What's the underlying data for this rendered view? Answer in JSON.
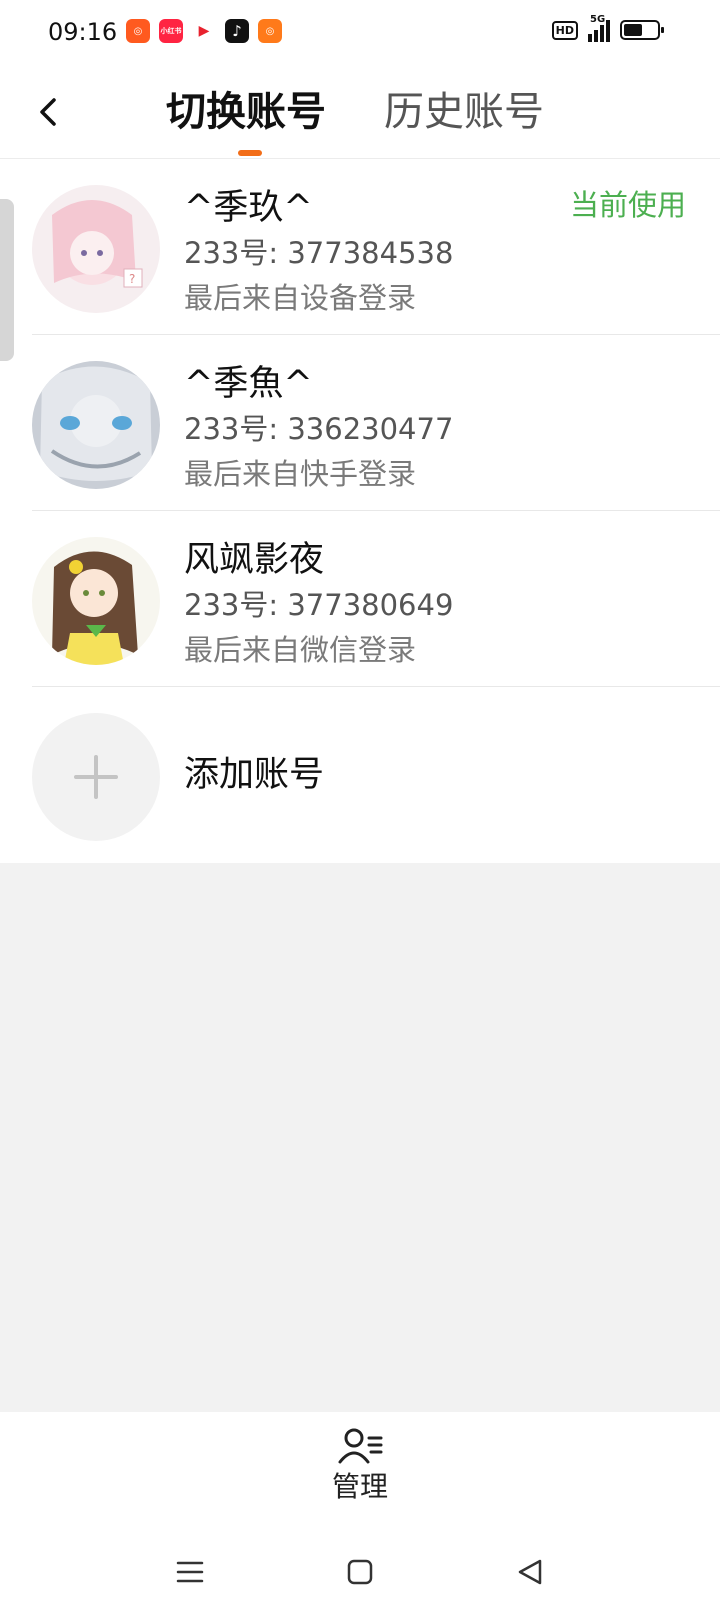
{
  "status_bar": {
    "time": "09:16",
    "hd": "HD",
    "network": "5G",
    "battery_level": 0.55,
    "app_icons": [
      {
        "name": "kuaishou-icon",
        "color": "#ff5a1f",
        "glyph": "⦿"
      },
      {
        "name": "xiaohongshu-icon",
        "color": "#ff2442",
        "glyph": "小红书"
      },
      {
        "name": "red-play-icon",
        "color": "#ffffff",
        "glyph": "▶"
      },
      {
        "name": "tiktok-icon",
        "color": "#111111",
        "glyph": "♪"
      },
      {
        "name": "kuaishou-lite-icon",
        "color": "#ff7a1a",
        "glyph": "⦿"
      }
    ]
  },
  "header": {
    "tab_active": "切换账号",
    "tab_inactive": "历史账号",
    "accent_color": "#f26d18"
  },
  "accounts": [
    {
      "name": "^季玖^",
      "uid": "233号: 377384538",
      "source": "最后来自设备登录",
      "badge": "当前使用"
    },
    {
      "name": "^季魚^",
      "uid": "233号: 336230477",
      "source": "最后来自快手登录"
    },
    {
      "name": "风飒影夜",
      "uid": "233号: 377380649",
      "source": "最后来自微信登录"
    }
  ],
  "add_account": {
    "label": "添加账号"
  },
  "bottom": {
    "manage_label": "管理"
  },
  "colors": {
    "current_badge": "#4caf50",
    "background": "#f2f2f2"
  }
}
